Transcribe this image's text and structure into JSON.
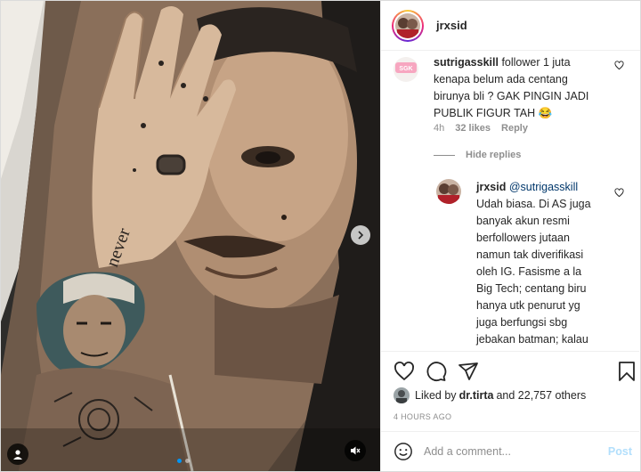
{
  "post": {
    "author": "jrxsid",
    "carousel": {
      "total_slides": 2,
      "active_slide": 1
    }
  },
  "comments": [
    {
      "username": "sutrigasskill",
      "text": "follower 1 juta kenapa belum ada centang birunya bli ? GAK PINGIN JADI PUBLIK FIGUR TAH 😂",
      "time": "4h",
      "likes": "32 likes",
      "reply_label": "Reply",
      "hide_replies_label": "Hide replies"
    }
  ],
  "reply": {
    "username": "jrxsid",
    "mention": "@sutrigasskill",
    "text": "Udah biasa. Di AS juga banyak akun resmi berfollowers jutaan namun tak diverifikasi oleh IG. Fasisme a la Big Tech; centang biru hanya utk penurut yg juga berfungsi sbg jebakan batman; kalau bandel, centang/akunnya dihapus. Trump aja"
  },
  "likes": {
    "prefix": "Liked by",
    "user": "dr.tirta",
    "suffix": "and 22,757 others"
  },
  "timestamp": "4 HOURS AGO",
  "add_comment": {
    "placeholder": "Add a comment...",
    "post_label": "Post"
  },
  "colors": {
    "accent": "#0095f6",
    "post_button_disabled": "#b2dffc",
    "muted_text": "#8e8e8e"
  }
}
